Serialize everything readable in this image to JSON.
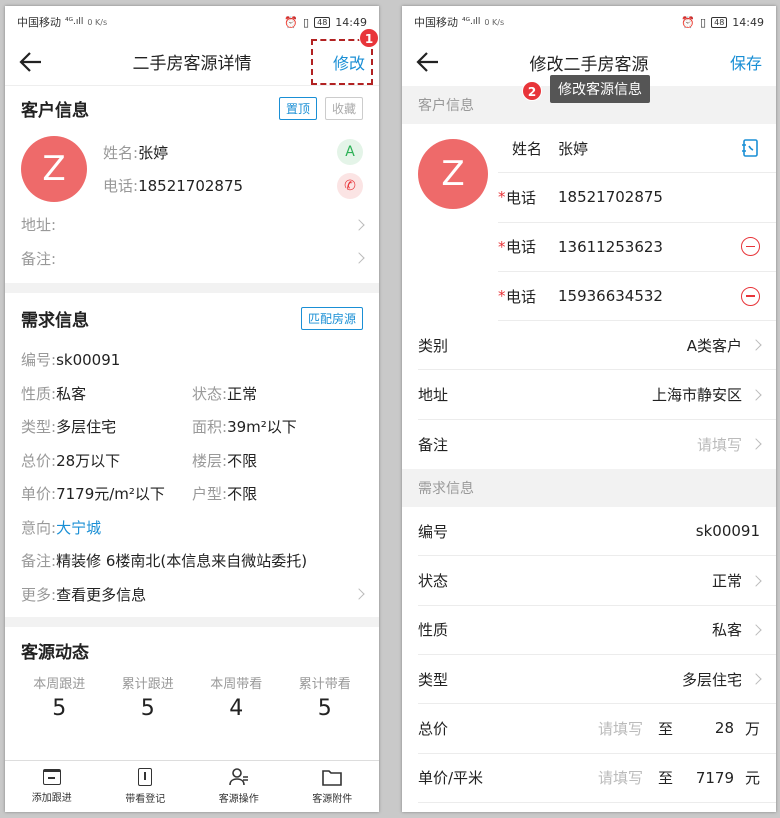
{
  "status": {
    "carrier": "中国移动",
    "signal": "⁴ᴳ.ıll",
    "speed": "0 K/s",
    "battery": "48",
    "time": "14:49",
    "icons": [
      "alarm-icon",
      "vibrate-icon"
    ]
  },
  "left": {
    "title": "二手房客源详情",
    "edit_label": "修改",
    "step_badge": "1",
    "customer": {
      "header": "客户信息",
      "pin_label": "置顶",
      "fav_label": "收藏",
      "avatar_letter": "Z",
      "name_label": "姓名:",
      "name_value": "张婷",
      "grade_badge": "A",
      "phone_label": "电话:",
      "phone_value": "18521702875",
      "address_label": "地址:",
      "note_label": "备注:"
    },
    "demand": {
      "header": "需求信息",
      "match_label": "匹配房源",
      "id_label": "编号:",
      "id_value": "sk00091",
      "nature_label": "性质:",
      "nature_value": "私客",
      "state_label": "状态:",
      "state_value": "正常",
      "type_label": "类型:",
      "type_value": "多层住宅",
      "area_label": "面积:",
      "area_value": "39m²以下",
      "total_label": "总价:",
      "total_value": "28万以下",
      "floor_label": "楼层:",
      "floor_value": "不限",
      "unit_label": "单价:",
      "unit_value": "7179元/m²以下",
      "layout_label": "户型:",
      "layout_value": "不限",
      "intent_label": "意向:",
      "intent_value": "大宁城",
      "note_label": "备注:",
      "note_value": "精装修 6楼南北(本信息来自微站委托)",
      "more_label": "更多:",
      "more_value": "查看更多信息"
    },
    "dynamics": {
      "header": "客源动态",
      "stats": [
        {
          "label": "本周跟进",
          "value": "5"
        },
        {
          "label": "累计跟进",
          "value": "5"
        },
        {
          "label": "本周带看",
          "value": "4"
        },
        {
          "label": "累计带看",
          "value": "5"
        }
      ]
    },
    "tabs": [
      {
        "label": "添加跟进",
        "icon": "calendar-add-icon"
      },
      {
        "label": "带看登记",
        "icon": "register-icon"
      },
      {
        "label": "客源操作",
        "icon": "user-action-icon"
      },
      {
        "label": "客源附件",
        "icon": "folder-icon"
      }
    ]
  },
  "right": {
    "title": "修改二手房客源",
    "save_label": "保存",
    "step_badge": "2",
    "tooltip": "修改客源信息",
    "customer_header": "客户信息",
    "avatar_letter": "Z",
    "name_label": "姓名",
    "name_value": "张婷",
    "phone_label": "电话",
    "phones": [
      "18521702875",
      "13611253623",
      "15936634532"
    ],
    "rows1": [
      {
        "label": "类别",
        "value": "A类客户",
        "placeholder": false
      },
      {
        "label": "地址",
        "value": "上海市静安区",
        "placeholder": false
      },
      {
        "label": "备注",
        "value": "请填写",
        "placeholder": true
      }
    ],
    "demand_header": "需求信息",
    "id_label": "编号",
    "id_value": "sk00091",
    "rows2": [
      {
        "label": "状态",
        "value": "正常"
      },
      {
        "label": "性质",
        "value": "私客"
      },
      {
        "label": "类型",
        "value": "多层住宅"
      }
    ],
    "total_label": "总价",
    "total_placeholder": "请填写",
    "total_to": "至",
    "total_value": "28",
    "total_unit": "万",
    "unit_label": "单价/平米",
    "unit_placeholder": "请填写",
    "unit_to": "至",
    "unit_value": "7179",
    "unit_unit": "元"
  }
}
